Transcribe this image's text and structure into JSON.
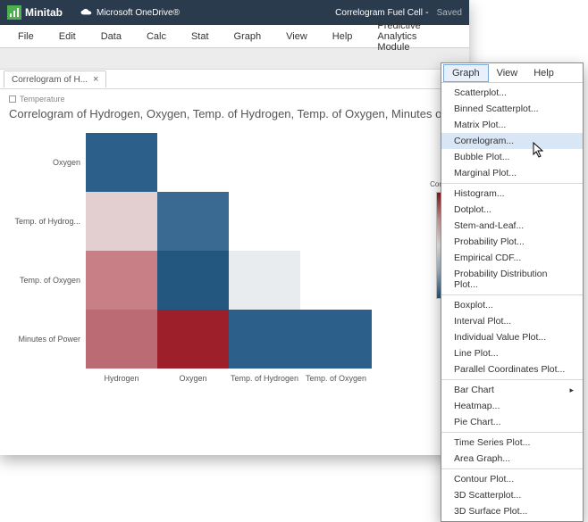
{
  "app": {
    "name": "Minitab",
    "storage": "Microsoft OneDrive®",
    "document": "Correlogram Fuel Cell",
    "save_status": "Saved"
  },
  "menubar": [
    "File",
    "Edit",
    "Data",
    "Calc",
    "Stat",
    "Graph",
    "View",
    "Help",
    "Predictive Analytics Module"
  ],
  "tab": {
    "label": "Correlogram of H...",
    "close": "×"
  },
  "content": {
    "above": "Temperature",
    "title": "Correlogram of Hydrogen, Oxygen, Temp. of Hydrogen, Temp. of Oxygen, Minutes of P"
  },
  "legend": {
    "title": "Correl"
  },
  "popup": {
    "menubar": [
      "Graph",
      "View",
      "Help"
    ],
    "groups": [
      [
        "Scatterplot...",
        "Binned Scatterplot...",
        "Matrix Plot...",
        "Correlogram...",
        "Bubble Plot...",
        "Marginal Plot..."
      ],
      [
        "Histogram...",
        "Dotplot...",
        "Stem-and-Leaf...",
        "Probability Plot...",
        "Empirical CDF...",
        "Probability Distribution Plot..."
      ],
      [
        "Boxplot...",
        "Interval Plot...",
        "Individual Value Plot...",
        "Line Plot...",
        "Parallel Coordinates Plot..."
      ],
      [
        "Bar Chart",
        "Heatmap...",
        "Pie Chart..."
      ],
      [
        "Time Series Plot...",
        "Area Graph..."
      ],
      [
        "Contour Plot...",
        "3D Scatterplot...",
        "3D Surface Plot..."
      ]
    ],
    "highlighted": "Correlogram...",
    "submenu_on": "Bar Chart"
  },
  "chart_data": {
    "type": "heatmap",
    "title": "Correlogram of Hydrogen, Oxygen, Temp. of Hydrogen, Temp. of Oxygen, Minutes of Power",
    "x": [
      "Hydrogen",
      "Oxygen",
      "Temp. of Hydrogen",
      "Temp. of Oxygen"
    ],
    "y": [
      "Oxygen",
      "Temp. of Hydrog...",
      "Temp. of Oxygen",
      "Minutes of Power"
    ],
    "legend_label": "Correlation",
    "color_scale": {
      "min": -1.0,
      "mid": 0.0,
      "max": 1.0,
      "min_color": "#24577f",
      "mid_color": "#f0f0f0",
      "max_color": "#8b1a1a"
    },
    "values": [
      [
        -0.75,
        null,
        null,
        null
      ],
      [
        0.15,
        -0.65,
        null,
        null
      ],
      [
        0.5,
        -0.8,
        -0.05,
        null
      ],
      [
        0.6,
        0.9,
        -0.75,
        -0.75
      ]
    ],
    "cell_colors": [
      [
        "#2c5f89",
        "",
        "",
        ""
      ],
      [
        "#e4cfd0",
        "#3a6a92",
        "",
        ""
      ],
      [
        "#c97f86",
        "#24577f",
        "#e9ecef",
        ""
      ],
      [
        "#bb6b74",
        "#9c1f2a",
        "#2c5f89",
        "#2c5f89"
      ]
    ]
  }
}
